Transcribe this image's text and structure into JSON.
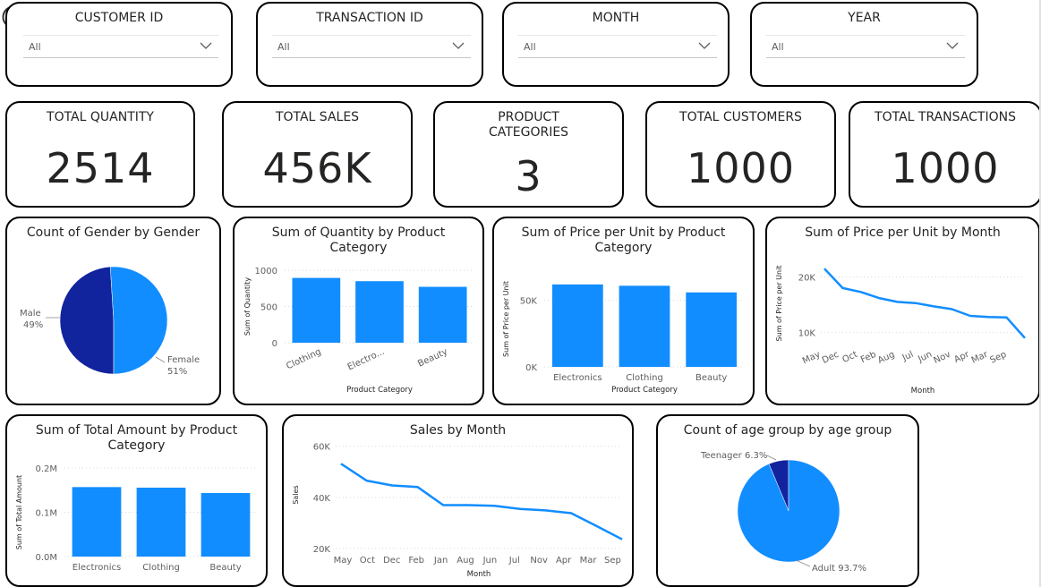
{
  "filters": [
    {
      "title": "CUSTOMER ID",
      "value": "All"
    },
    {
      "title": "TRANSACTION ID",
      "value": "All"
    },
    {
      "title": "MONTH",
      "value": "All"
    },
    {
      "title": "YEAR",
      "value": "All"
    }
  ],
  "kpis": [
    {
      "title": "TOTAL QUANTITY",
      "value": "2514"
    },
    {
      "title": "TOTAL SALES",
      "value": "456K"
    },
    {
      "title": "PRODUCT CATEGORIES",
      "value": "3"
    },
    {
      "title": "TOTAL CUSTOMERS",
      "value": "1000"
    },
    {
      "title": "TOTAL TRANSACTIONS",
      "value": "1000"
    }
  ],
  "chart_titles": {
    "gender": "Count of Gender by Gender",
    "qty": "Sum of Quantity by Product Category",
    "ppu_cat": "Sum of Price per Unit by Product Category",
    "ppu_month": "Sum of Price per Unit by Month",
    "total_amount": "Sum of Total Amount by Product Category",
    "sales_month": "Sales by Month",
    "age": "Count of age group by age group"
  },
  "colors": {
    "primary": "#118DFF",
    "dark": "#12239E",
    "grid": "#d9d9d9",
    "axis_text": "#605e5c"
  },
  "chart_data": [
    {
      "id": "gender",
      "type": "pie",
      "slices": [
        {
          "label": "Male",
          "pct": "49%",
          "value": 49,
          "color": "#12239E"
        },
        {
          "label": "Female",
          "pct": "51%",
          "value": 51,
          "color": "#118DFF"
        }
      ]
    },
    {
      "id": "qty",
      "type": "bar",
      "categories": [
        "Clothing",
        "Electro...",
        "Beauty"
      ],
      "values": [
        894,
        849,
        771
      ],
      "ylabel": "Sum of Quantity",
      "xlabel": "Product Category",
      "ylim": [
        0,
        1000
      ],
      "yticks": [
        0,
        500,
        1000
      ],
      "ytick_labels": [
        "0",
        "500",
        "1000"
      ],
      "grid": true
    },
    {
      "id": "ppu_cat",
      "type": "bar",
      "categories": [
        "Electronics",
        "Clothing",
        "Beauty"
      ],
      "values": [
        62000,
        61000,
        56000
      ],
      "ylabel": "Sum of Price per Unit",
      "xlabel": "Product Category",
      "ylim": [
        0,
        72000
      ],
      "yticks": [
        0,
        50000
      ],
      "ytick_labels": [
        "0K",
        "50K"
      ],
      "grid": true
    },
    {
      "id": "ppu_month",
      "type": "line",
      "categories": [
        "May",
        "Dec",
        "Oct",
        "Feb",
        "Aug",
        "Jul",
        "Jun",
        "Nov",
        "Apr",
        "Mar",
        "Sep"
      ],
      "values": [
        21500,
        18000,
        17300,
        16200,
        15500,
        15300,
        14700,
        14200,
        13000,
        12800,
        12700,
        9000
      ],
      "ylabel": "Sum of Price per Unit",
      "xlabel": "Month",
      "ylim": [
        8000,
        22500
      ],
      "yticks": [
        10000,
        20000
      ],
      "ytick_labels": [
        "10K",
        "20K"
      ],
      "grid": true
    },
    {
      "id": "total_amount",
      "type": "bar",
      "categories": [
        "Electronics",
        "Clothing",
        "Beauty"
      ],
      "values": [
        156905,
        155580,
        143515
      ],
      "ylabel": "Sum of Total Amount",
      "xlabel": "",
      "ylim": [
        0,
        200000
      ],
      "yticks": [
        0,
        100000,
        200000
      ],
      "ytick_labels": [
        "0.0M",
        "0.1M",
        "0.2M"
      ],
      "grid": true
    },
    {
      "id": "sales_month",
      "type": "line",
      "categories": [
        "May",
        "Oct",
        "Dec",
        "Feb",
        "Jan",
        "Aug",
        "Jun",
        "Jul",
        "Nov",
        "Apr",
        "Mar",
        "Sep"
      ],
      "values": [
        53150,
        46580,
        44690,
        44060,
        36980,
        36960,
        36715,
        35465,
        34920,
        33870,
        28800,
        23620
      ],
      "ylabel": "Sales",
      "xlabel": "Month",
      "ylim": [
        20000,
        62000
      ],
      "yticks": [
        20000,
        40000,
        60000
      ],
      "ytick_labels": [
        "20K",
        "40K",
        "60K"
      ],
      "grid": true
    },
    {
      "id": "age",
      "type": "pie",
      "slices": [
        {
          "label": "Teenager",
          "pct": "6.3%",
          "value": 6.3,
          "color": "#12239E"
        },
        {
          "label": "Adult",
          "pct": "93.7%",
          "value": 93.7,
          "color": "#118DFF"
        }
      ]
    }
  ]
}
